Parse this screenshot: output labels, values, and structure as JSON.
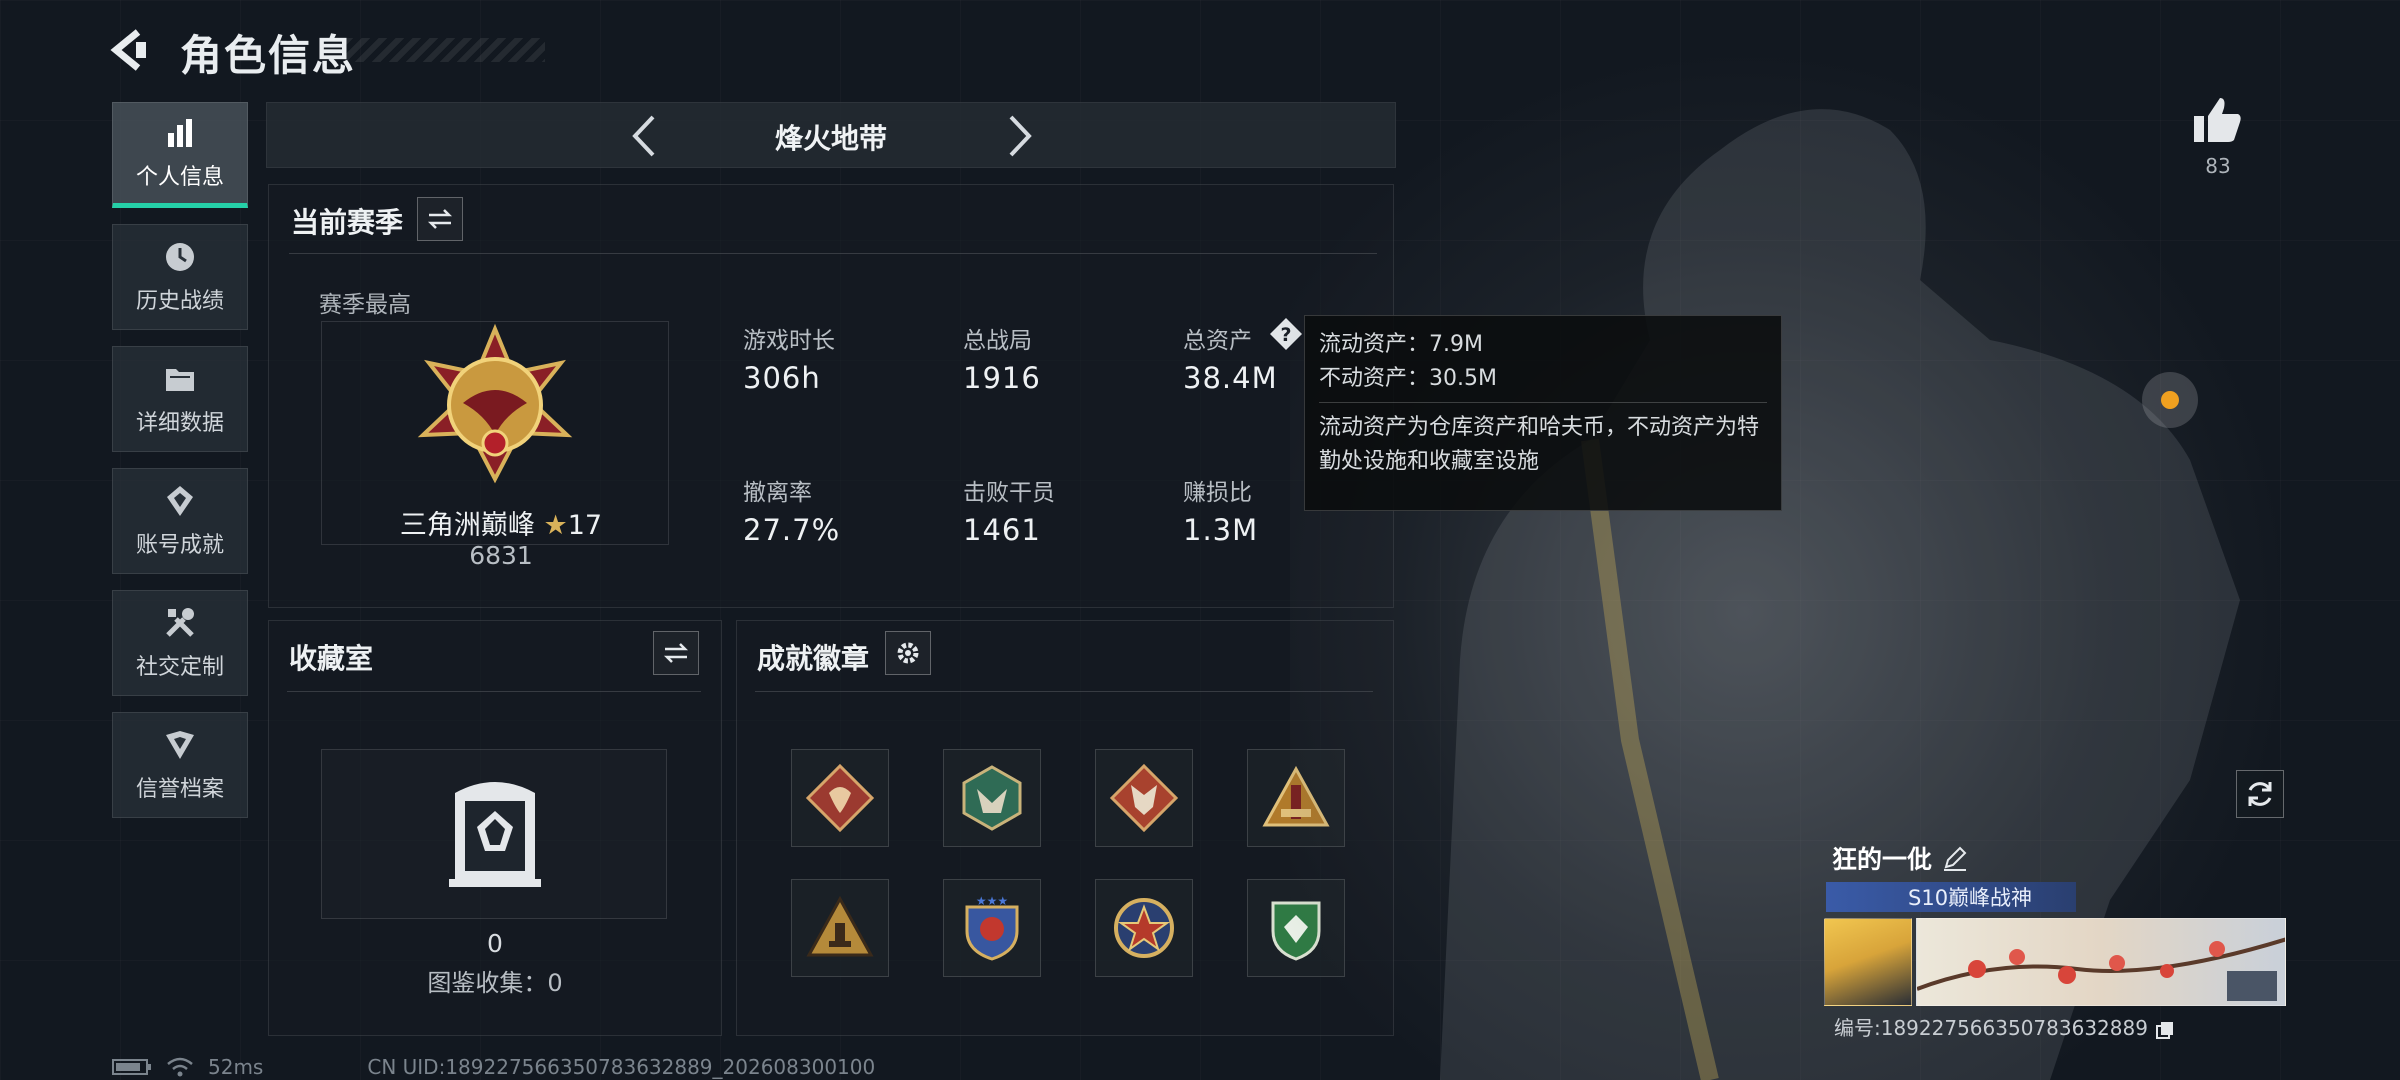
{
  "header": {
    "title": "角色信息"
  },
  "sidebar": {
    "items": [
      {
        "label": "个人信息",
        "icon": "bar-chart-icon",
        "active": true
      },
      {
        "label": "历史战绩",
        "icon": "history-clock-icon",
        "active": false
      },
      {
        "label": "详细数据",
        "icon": "folder-icon",
        "active": false
      },
      {
        "label": "账号成就",
        "icon": "achievement-icon",
        "active": false
      },
      {
        "label": "社交定制",
        "icon": "tools-icon",
        "active": false
      },
      {
        "label": "信誉档案",
        "icon": "credit-badge-icon",
        "active": false
      }
    ]
  },
  "mode": {
    "label": "烽火地带"
  },
  "season": {
    "title": "当前赛季",
    "best_label": "赛季最高",
    "rank_name": "三角洲巅峰",
    "rank_stars": "17",
    "rank_score": "6831",
    "stats": [
      {
        "label": "游戏时长",
        "value": "306h"
      },
      {
        "label": "总战局",
        "value": "1916"
      },
      {
        "label": "总资产",
        "value": "38.4M"
      },
      {
        "label": "撤离率",
        "value": "27.7%"
      },
      {
        "label": "击败干员",
        "value": "1461"
      },
      {
        "label": "赚损比",
        "value": "1.3M"
      }
    ]
  },
  "tooltip": {
    "liquid": "流动资产：7.9M",
    "fixed": "不动资产：30.5M",
    "note": "流动资产为仓库资产和哈夫币，不动资产为特勤处设施和收藏室设施"
  },
  "collection": {
    "title": "收藏室",
    "count": "0",
    "catalog": "图鉴收集：0"
  },
  "badges": {
    "title": "成就徽章",
    "items": [
      {
        "icon": "dragon-badge-icon",
        "color": "#9b3a30"
      },
      {
        "icon": "wolf-hex-badge-icon",
        "color": "#2f6b55"
      },
      {
        "icon": "fox-badge-icon",
        "color": "#a8422e"
      },
      {
        "icon": "tower-badge-icon",
        "color": "#b07a2a"
      },
      {
        "icon": "pyramid-badge-icon",
        "color": "#b58a3a"
      },
      {
        "icon": "shield-star-badge-icon",
        "color": "#3857a0"
      },
      {
        "icon": "star-medal-badge-icon",
        "color": "#b53a2a"
      },
      {
        "icon": "green-shield-badge-icon",
        "color": "#2f7a44"
      }
    ]
  },
  "profile": {
    "likes": "83",
    "name": "狂的一仳",
    "title_tag": "S10巅峰战神",
    "id_line": "编号:1892275663507836328​89"
  },
  "status": {
    "ping": "52ms",
    "uid": "CN UID:18922756635078363288​9_202608300100"
  }
}
